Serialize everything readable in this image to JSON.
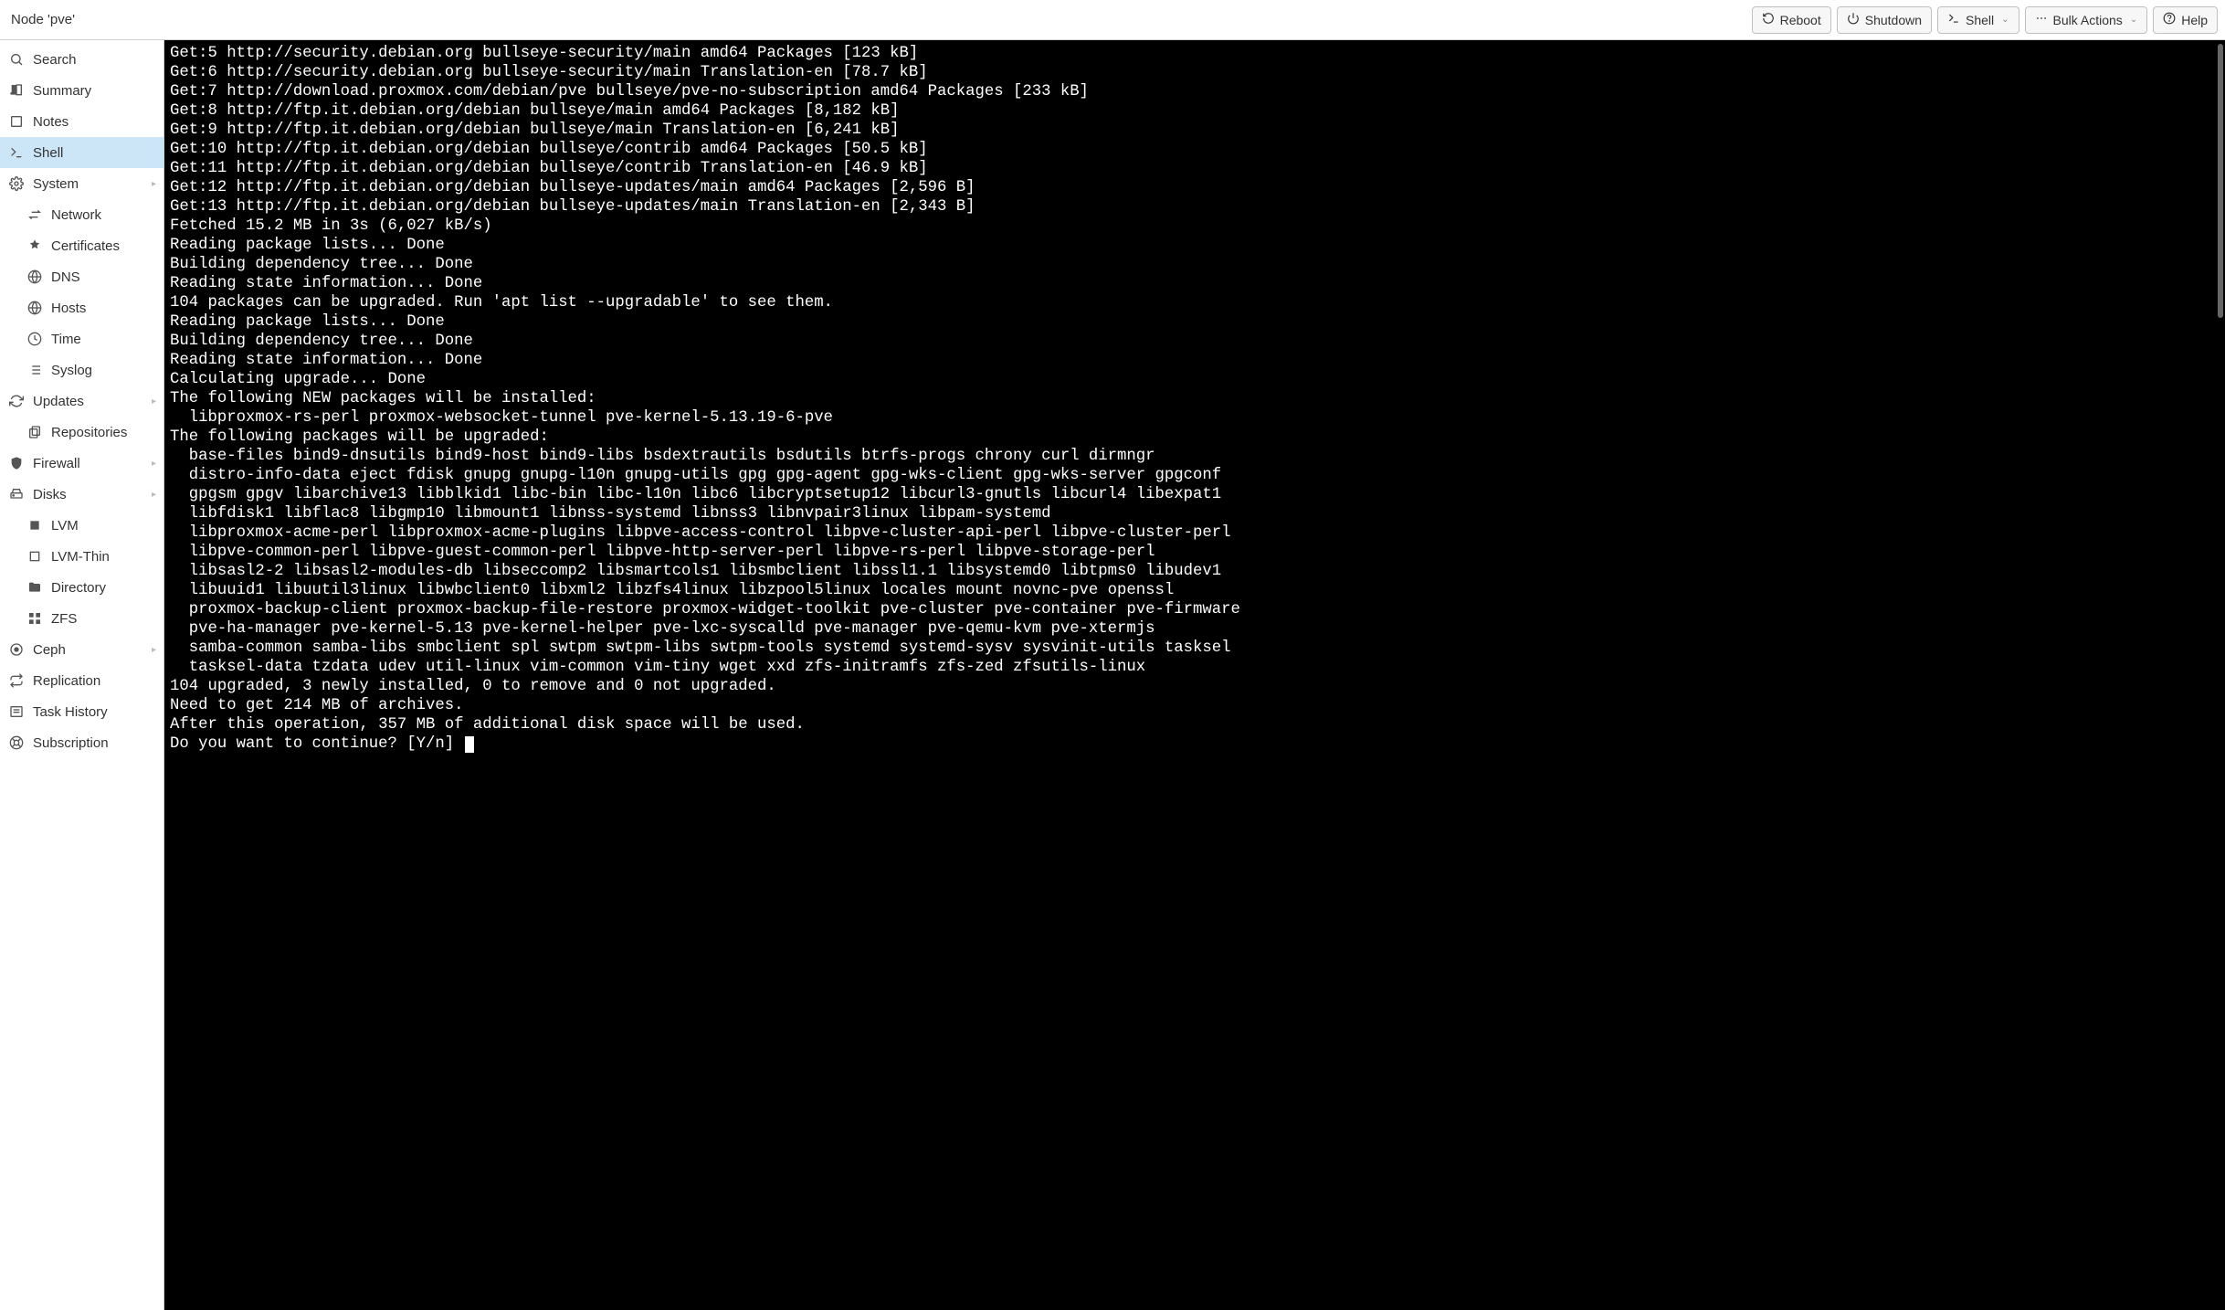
{
  "header": {
    "title": "Node 'pve'",
    "buttons": {
      "reboot": "Reboot",
      "shutdown": "Shutdown",
      "shell": "Shell",
      "bulk_actions": "Bulk Actions",
      "help": "Help"
    }
  },
  "sidebar": {
    "items": [
      {
        "id": "search",
        "label": "Search",
        "icon": "search",
        "indent": false
      },
      {
        "id": "summary",
        "label": "Summary",
        "icon": "book",
        "indent": false
      },
      {
        "id": "notes",
        "label": "Notes",
        "icon": "sticky",
        "indent": false
      },
      {
        "id": "shell",
        "label": "Shell",
        "icon": "terminal",
        "indent": false,
        "selected": true
      },
      {
        "id": "system",
        "label": "System",
        "icon": "cogs",
        "indent": false,
        "expandable": true
      },
      {
        "id": "network",
        "label": "Network",
        "icon": "exchange",
        "indent": true
      },
      {
        "id": "certificates",
        "label": "Certificates",
        "icon": "certificate",
        "indent": true
      },
      {
        "id": "dns",
        "label": "DNS",
        "icon": "globe",
        "indent": true
      },
      {
        "id": "hosts",
        "label": "Hosts",
        "icon": "globe",
        "indent": true
      },
      {
        "id": "time",
        "label": "Time",
        "icon": "clock",
        "indent": true
      },
      {
        "id": "syslog",
        "label": "Syslog",
        "icon": "list",
        "indent": true
      },
      {
        "id": "updates",
        "label": "Updates",
        "icon": "refresh",
        "indent": false,
        "expandable": true
      },
      {
        "id": "repositories",
        "label": "Repositories",
        "icon": "files",
        "indent": true
      },
      {
        "id": "firewall",
        "label": "Firewall",
        "icon": "shield",
        "indent": false,
        "expandable": true
      },
      {
        "id": "disks",
        "label": "Disks",
        "icon": "hdd",
        "indent": false,
        "expandable": true
      },
      {
        "id": "lvm",
        "label": "LVM",
        "icon": "square",
        "indent": true
      },
      {
        "id": "lvm-thin",
        "label": "LVM-Thin",
        "icon": "square-o",
        "indent": true
      },
      {
        "id": "directory",
        "label": "Directory",
        "icon": "folder",
        "indent": true
      },
      {
        "id": "zfs",
        "label": "ZFS",
        "icon": "th",
        "indent": true
      },
      {
        "id": "ceph",
        "label": "Ceph",
        "icon": "ceph",
        "indent": false,
        "expandable": true
      },
      {
        "id": "replication",
        "label": "Replication",
        "icon": "retweet",
        "indent": false
      },
      {
        "id": "task-history",
        "label": "Task History",
        "icon": "tasklist",
        "indent": false
      },
      {
        "id": "subscription",
        "label": "Subscription",
        "icon": "support",
        "indent": false
      }
    ]
  },
  "terminal": {
    "lines": [
      "Get:5 http://security.debian.org bullseye-security/main amd64 Packages [123 kB]",
      "Get:6 http://security.debian.org bullseye-security/main Translation-en [78.7 kB]",
      "Get:7 http://download.proxmox.com/debian/pve bullseye/pve-no-subscription amd64 Packages [233 kB]",
      "Get:8 http://ftp.it.debian.org/debian bullseye/main amd64 Packages [8,182 kB]",
      "Get:9 http://ftp.it.debian.org/debian bullseye/main Translation-en [6,241 kB]",
      "Get:10 http://ftp.it.debian.org/debian bullseye/contrib amd64 Packages [50.5 kB]",
      "Get:11 http://ftp.it.debian.org/debian bullseye/contrib Translation-en [46.9 kB]",
      "Get:12 http://ftp.it.debian.org/debian bullseye-updates/main amd64 Packages [2,596 B]",
      "Get:13 http://ftp.it.debian.org/debian bullseye-updates/main Translation-en [2,343 B]",
      "Fetched 15.2 MB in 3s (6,027 kB/s)",
      "Reading package lists... Done",
      "Building dependency tree... Done",
      "Reading state information... Done",
      "104 packages can be upgraded. Run 'apt list --upgradable' to see them.",
      "Reading package lists... Done",
      "Building dependency tree... Done",
      "Reading state information... Done",
      "Calculating upgrade... Done",
      "The following NEW packages will be installed:",
      "  libproxmox-rs-perl proxmox-websocket-tunnel pve-kernel-5.13.19-6-pve",
      "The following packages will be upgraded:",
      "  base-files bind9-dnsutils bind9-host bind9-libs bsdextrautils bsdutils btrfs-progs chrony curl dirmngr",
      "  distro-info-data eject fdisk gnupg gnupg-l10n gnupg-utils gpg gpg-agent gpg-wks-client gpg-wks-server gpgconf",
      "  gpgsm gpgv libarchive13 libblkid1 libc-bin libc-l10n libc6 libcryptsetup12 libcurl3-gnutls libcurl4 libexpat1",
      "  libfdisk1 libflac8 libgmp10 libmount1 libnss-systemd libnss3 libnvpair3linux libpam-systemd",
      "  libproxmox-acme-perl libproxmox-acme-plugins libpve-access-control libpve-cluster-api-perl libpve-cluster-perl",
      "  libpve-common-perl libpve-guest-common-perl libpve-http-server-perl libpve-rs-perl libpve-storage-perl",
      "  libsasl2-2 libsasl2-modules-db libseccomp2 libsmartcols1 libsmbclient libssl1.1 libsystemd0 libtpms0 libudev1",
      "  libuuid1 libuutil3linux libwbclient0 libxml2 libzfs4linux libzpool5linux locales mount novnc-pve openssl",
      "  proxmox-backup-client proxmox-backup-file-restore proxmox-widget-toolkit pve-cluster pve-container pve-firmware",
      "  pve-ha-manager pve-kernel-5.13 pve-kernel-helper pve-lxc-syscalld pve-manager pve-qemu-kvm pve-xtermjs",
      "  samba-common samba-libs smbclient spl swtpm swtpm-libs swtpm-tools systemd systemd-sysv sysvinit-utils tasksel",
      "  tasksel-data tzdata udev util-linux vim-common vim-tiny wget xxd zfs-initramfs zfs-zed zfsutils-linux",
      "104 upgraded, 3 newly installed, 0 to remove and 0 not upgraded.",
      "Need to get 214 MB of archives.",
      "After this operation, 357 MB of additional disk space will be used.",
      "Do you want to continue? [Y/n] "
    ]
  }
}
